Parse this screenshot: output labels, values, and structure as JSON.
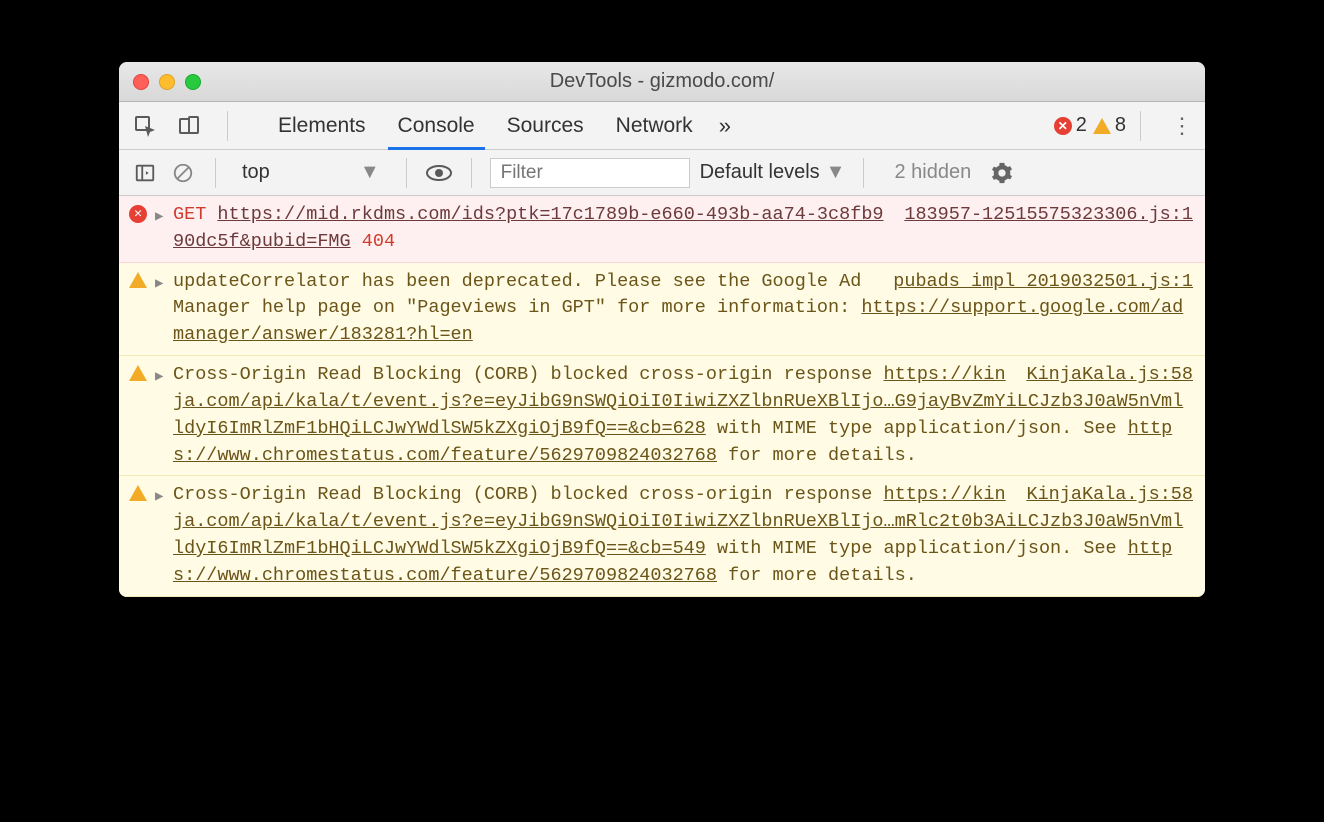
{
  "window": {
    "title": "DevTools - gizmodo.com/"
  },
  "tabbar": {
    "tabs": [
      "Elements",
      "Console",
      "Sources",
      "Network"
    ],
    "active_index": 1,
    "error_count": "2",
    "warning_count": "8"
  },
  "filterbar": {
    "context": "top",
    "filter_placeholder": "Filter",
    "levels_label": "Default levels",
    "hidden_label": "2 hidden"
  },
  "messages": [
    {
      "type": "error",
      "method": "GET",
      "url": "https://mid.rkdms.com/ids?ptk=17c1789b-e660-493b-aa74-3c8fb990dc5f&pubid=FMG",
      "status": "404",
      "source": "183957-12515575323306.js:1"
    },
    {
      "type": "warning",
      "text_before": "updateCorrelator has been deprecated. Please see the Google Ad Manager help page on \"Pageviews in GPT\" for more information: ",
      "url": "https://support.google.com/admanager/answer/183281?hl=en",
      "source": "pubads_impl_2019032501.js:1"
    },
    {
      "type": "warning",
      "text_before": "Cross-Origin Read Blocking (CORB) blocked cross-origin response ",
      "url": "https://kinja.com/api/kala/t/event.js?e=eyJibG9nSWQiOiI0IiwiZXZlbnRUeXBlIjo…G9jayBvZmYiLCJzb3J0aW5nVmlldyI6ImRlZmF1bHQiLCJwYWdlSW5kZXgiOjB9fQ==&cb=628",
      "text_after": " with MIME type application/json. See ",
      "url2": "https://www.chromestatus.com/feature/5629709824032768",
      "text_end": " for more details.",
      "source": "KinjaKala.js:58"
    },
    {
      "type": "warning",
      "text_before": "Cross-Origin Read Blocking (CORB) blocked cross-origin response ",
      "url": "https://kinja.com/api/kala/t/event.js?e=eyJibG9nSWQiOiI0IiwiZXZlbnRUeXBlIjo…mRlc2t0b3AiLCJzb3J0aW5nVmlldyI6ImRlZmF1bHQiLCJwYWdlSW5kZXgiOjB9fQ==&cb=549",
      "text_after": " with MIME type application/json. See ",
      "url2": "https://www.chromestatus.com/feature/5629709824032768",
      "text_end": " for more details.",
      "source": "KinjaKala.js:58"
    }
  ]
}
